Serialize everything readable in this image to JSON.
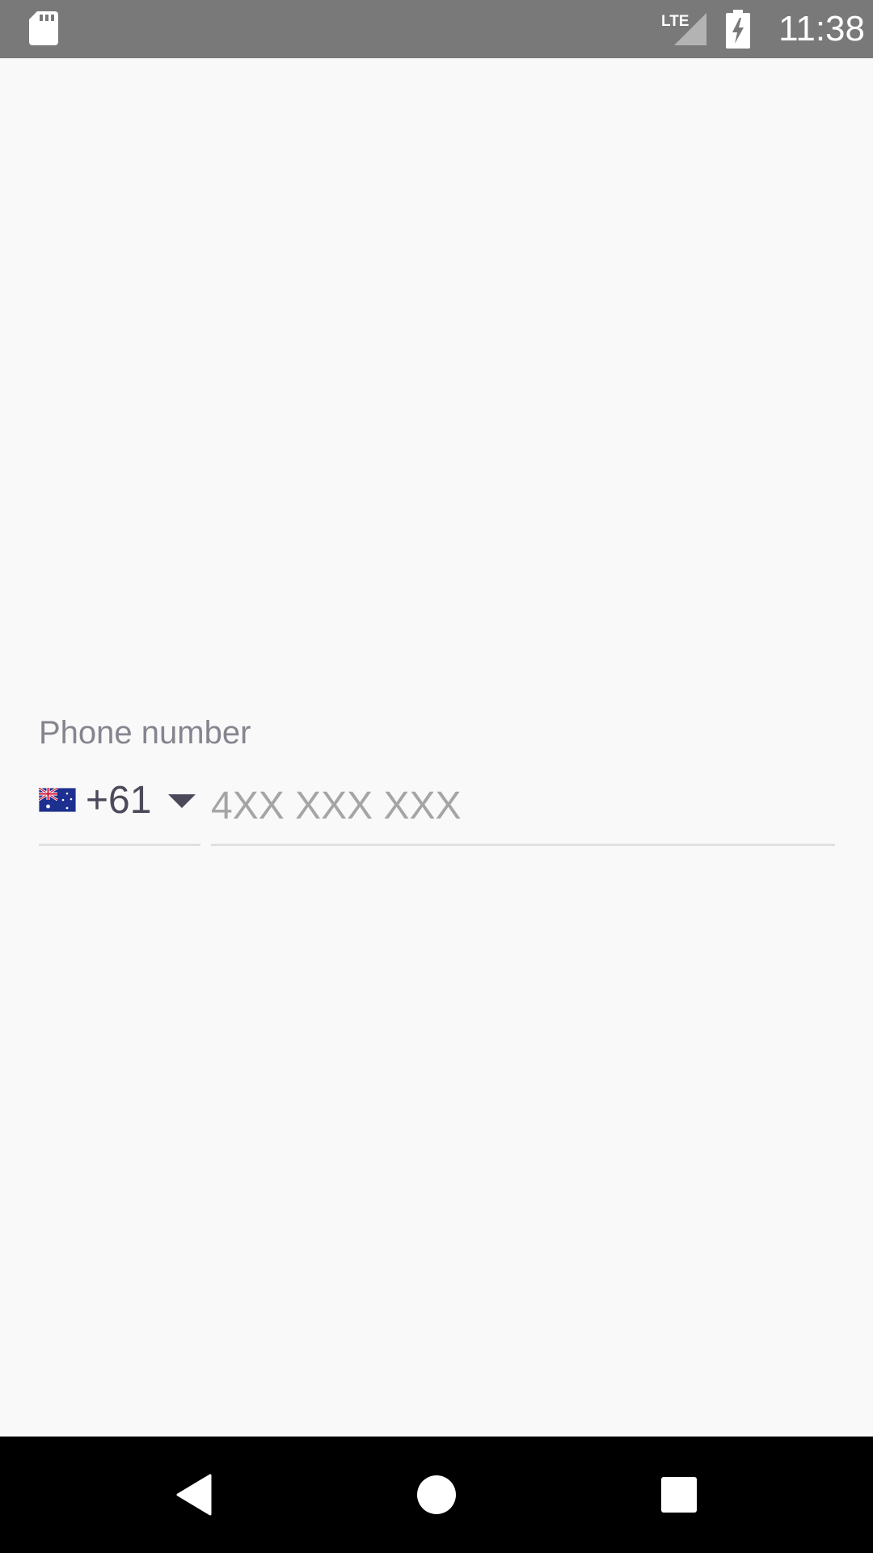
{
  "status_bar": {
    "time": "11:38",
    "network": "LTE",
    "icons": [
      "sd-card-icon",
      "lte-signal-icon",
      "battery-charging-icon"
    ],
    "background": "#797979"
  },
  "phone_field": {
    "label": "Phone number",
    "country": {
      "flag": "australia-flag-icon",
      "dial_code": "+61"
    },
    "number": {
      "value": "",
      "placeholder": "4XX XXX XXX"
    }
  },
  "nav_bar": {
    "icons": [
      "back-icon",
      "home-icon",
      "recents-icon"
    ]
  },
  "colors": {
    "background": "#f9f9f9",
    "label": "#86858f",
    "text": "#4c4a5a",
    "placeholder": "#a5a5a5",
    "underline": "#e0e0e0"
  }
}
